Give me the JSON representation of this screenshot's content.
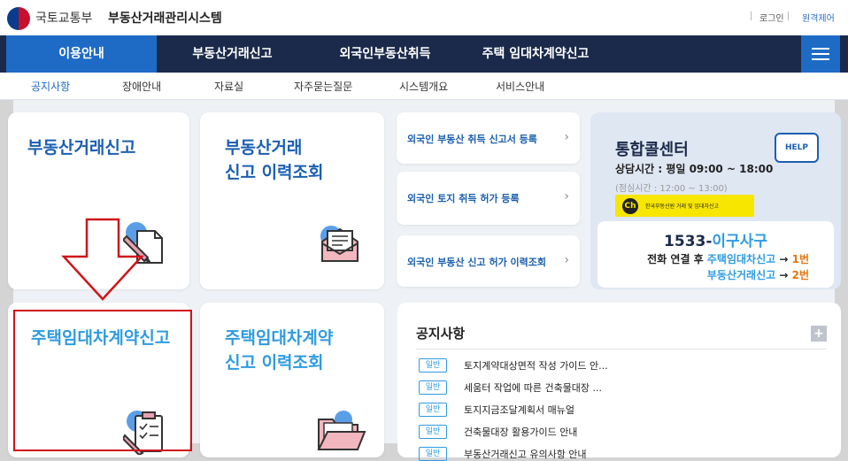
{
  "header": {
    "ministry": "국토교통부",
    "system_title": "부동산거래관리시스템",
    "login": "로그인",
    "remote": "원격제어"
  },
  "gnb": {
    "items": [
      "이용안내",
      "부동산거래신고",
      "외국인부동산취득",
      "주택 임대차계약신고"
    ],
    "active_index": 0
  },
  "subnav": {
    "items": [
      "공지사항",
      "장애안내",
      "자료실",
      "자주묻는질문",
      "시스템개요",
      "서비스안내"
    ],
    "active_index": 0
  },
  "cards": {
    "realestate_report": "부동산거래신고",
    "realestate_history": "부동산거래\n신고 이력조회",
    "lease_report": "주택임대차계약신고",
    "lease_history": "주택임대차계약\n신고 이력조회"
  },
  "foreign_links": [
    "외국인 부동산 취득 신고서 등록",
    "외국인 토지 취득 허가 등록",
    "외국인 부동산 신고 허가 이력조회"
  ],
  "callcenter": {
    "title": "통합콜센터",
    "hours": "상담시간 : 평일 09:00 ~ 18:00",
    "lunch": "(점심시간 : 12:00 ~ 13:00)",
    "kakao_badge": "Ch",
    "kakao_text": "한국부동산원 거래 및 임대차신고",
    "help": "HELP",
    "phone_number": "1533-",
    "phone_word": "이구사구",
    "line1_prefix": "전화 연결 후",
    "line1_target": "주택임대차신고",
    "line1_arrow": "→",
    "line1_key": "1번",
    "line2_target": "부동산거래신고",
    "line2_arrow": "→",
    "line2_key": "2번"
  },
  "notice": {
    "title": "공지사항",
    "more": "+",
    "badge": "일반",
    "items": [
      "토지계약대상면적 작성 가이드 안...",
      "세움터 작업에 따른 건축물대장 ...",
      "토지지금조달계획서 매뉴얼",
      "건축물대장 활용가이드 안내",
      "부동산거래신고 유의사항 안내"
    ]
  },
  "colors": {
    "nav_dark": "#1b2a4a",
    "nav_active": "#1e6bc6",
    "title_dark": "#1b5fb0",
    "title_light": "#2e9be0",
    "highlight_box": "#d0151b",
    "kakao": "#f7e600"
  },
  "icons": [
    "pencil-document-icon",
    "mail-open-icon",
    "clipboard-checklist-icon",
    "folder-open-icon",
    "help-bubble-icon",
    "hamburger-menu-icon",
    "chevron-right-icon",
    "down-arrow-icon"
  ]
}
